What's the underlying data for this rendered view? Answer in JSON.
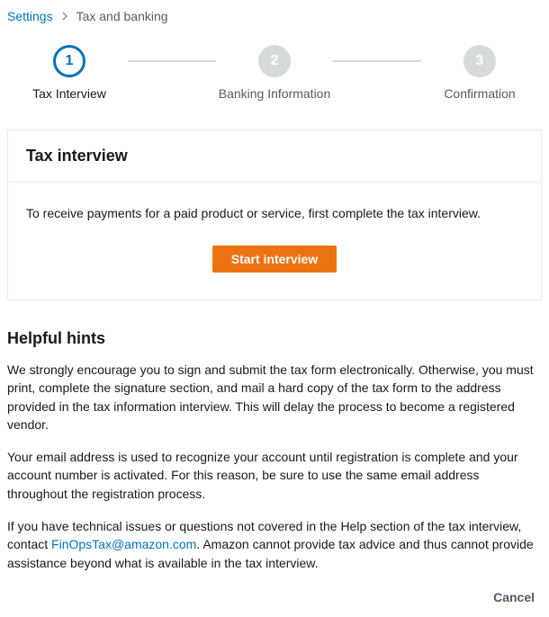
{
  "breadcrumb": {
    "root": "Settings",
    "current": "Tax and banking"
  },
  "stepper": {
    "steps": [
      {
        "num": "1",
        "label": "Tax Interview"
      },
      {
        "num": "2",
        "label": "Banking Information"
      },
      {
        "num": "3",
        "label": "Confirmation"
      }
    ]
  },
  "panel": {
    "title": "Tax interview",
    "body": "To receive payments for a paid product or service, first complete the tax interview.",
    "cta": "Start interview"
  },
  "hints": {
    "title": "Helpful hints",
    "p1": "We strongly encourage you to sign and submit the tax form electronically. Otherwise, you must print, complete the signature section, and mail a hard copy of the tax form to the address provided in the tax information interview. This will delay the process to become a registered vendor.",
    "p2": "Your email address is used to recognize your account until registration is complete and your account number is activated. For this reason, be sure to use the same email address throughout the registration process.",
    "p3a": "If you have technical issues or questions not covered in the Help section of the tax interview, contact ",
    "email": "FinOpsTax@amazon.com",
    "p3b": ". Amazon cannot provide tax advice and thus cannot provide assistance beyond what is available in the tax interview."
  },
  "footer": {
    "cancel": "Cancel"
  }
}
